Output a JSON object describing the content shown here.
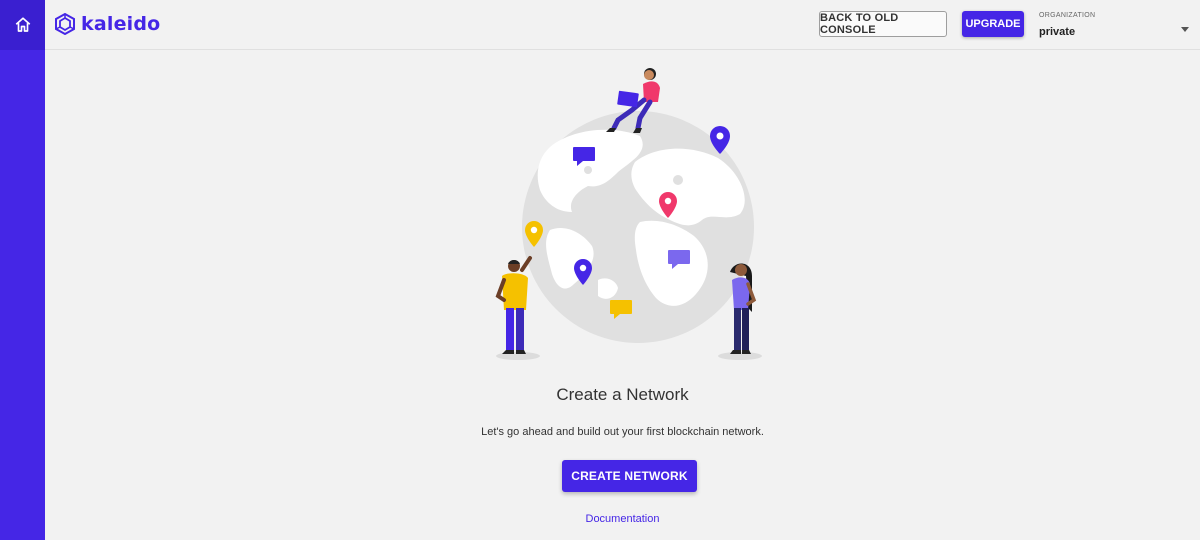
{
  "app": {
    "name": "kaleido"
  },
  "nav": {
    "home_icon": "home-icon"
  },
  "header": {
    "back_label": "BACK TO OLD CONSOLE",
    "upgrade_label": "UPGRADE",
    "org_label": "ORGANIZATION",
    "org_value": "private"
  },
  "main": {
    "title": "Create a Network",
    "subtitle": "Let's go ahead and build out your first blockchain network.",
    "create_label": "CREATE NETWORK",
    "doc_label": "Documentation"
  },
  "colors": {
    "brand": "#4526e6",
    "pin_pink": "#f0386b",
    "pin_yellow": "#f5c100",
    "globe": "#e0e0e0",
    "land": "#ffffff"
  }
}
